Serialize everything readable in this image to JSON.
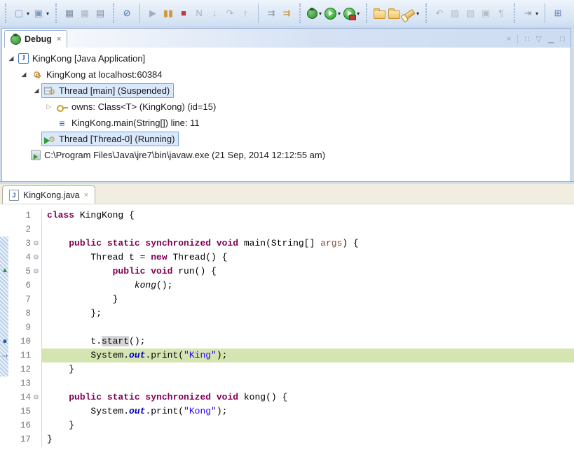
{
  "toolbar": {
    "groups": [
      {
        "sep": "dots",
        "items": [
          {
            "name": "new-button",
            "glyph": "▢",
            "color": "#7a98c0",
            "dropdown": true
          },
          {
            "name": "new-wizard-button",
            "glyph": "▣",
            "color": "#7a98c0",
            "dropdown": true
          }
        ]
      },
      {
        "sep": "dots",
        "items": [
          {
            "name": "save-button",
            "glyph": "▦",
            "color": "#7b8ca0"
          },
          {
            "name": "save-all-button",
            "glyph": "▦",
            "color": "#aab4be"
          },
          {
            "name": "print-button",
            "glyph": "▤",
            "color": "#7b8ca0"
          }
        ]
      },
      {
        "sep": "dots",
        "items": [
          {
            "name": "skip-all-breakpoints-button",
            "glyph": "⊘",
            "color": "#3a6ab0"
          }
        ]
      },
      {
        "sep": "line",
        "items": [
          {
            "name": "resume-button",
            "glyph": "▶",
            "color": "#9fafbf"
          },
          {
            "name": "suspend-button",
            "glyph": "▮▮",
            "color": "#d09a3a"
          },
          {
            "name": "terminate-button",
            "glyph": "■",
            "color": "#c03a3a"
          },
          {
            "name": "disconnect-button",
            "glyph": "N",
            "color": "#a8b2bc"
          },
          {
            "name": "step-into-button",
            "glyph": "↓",
            "color": "#a8b2bc"
          },
          {
            "name": "step-over-button",
            "glyph": "↷",
            "color": "#a8b2bc"
          },
          {
            "name": "step-return-button",
            "glyph": "↑",
            "color": "#a8b2bc"
          }
        ]
      },
      {
        "sep": "line",
        "items": [
          {
            "name": "step-filters-button",
            "glyph": "⇉",
            "color": "#8a97a8"
          },
          {
            "name": "use-step-filters-button",
            "glyph": "⇉",
            "color": "#c89232"
          }
        ]
      },
      {
        "sep": "dots",
        "items": [
          {
            "name": "debug-button",
            "css": "ci-bug",
            "dropdown": true
          },
          {
            "name": "run-button",
            "css": "ci-run",
            "dropdown": true
          },
          {
            "name": "run-external-tool-button",
            "css": "ci-run-ext",
            "dropdown": true
          }
        ]
      },
      {
        "sep": "dots",
        "items": [
          {
            "name": "open-type-button",
            "css": "ci-folder"
          },
          {
            "name": "open-resource-button",
            "css": "ci-folder"
          },
          {
            "name": "search-button",
            "css": "ci-torch",
            "dropdown": true
          }
        ]
      },
      {
        "sep": "dots",
        "items": [
          {
            "name": "last-edit-location-button",
            "glyph": "↶",
            "color": "#a8b2bc"
          },
          {
            "name": "format-button",
            "glyph": "▨",
            "color": "#b4bcc4"
          },
          {
            "name": "mark-occurrences-button",
            "glyph": "▧",
            "color": "#b4bcc4"
          },
          {
            "name": "show-selected-element-button",
            "glyph": "▣",
            "color": "#b4bcc4"
          },
          {
            "name": "show-whitespace-button",
            "glyph": "¶",
            "color": "#b4bcc4"
          }
        ]
      },
      {
        "sep": "dots",
        "items": [
          {
            "name": "pin-editor-button",
            "glyph": "⇥",
            "color": "#8a97a8",
            "dropdown": true
          }
        ]
      },
      {
        "sep": "line",
        "items": [
          {
            "name": "open-perspective-button",
            "glyph": "⊞",
            "color": "#5a7ab0"
          }
        ]
      }
    ]
  },
  "debug": {
    "tab_label": "Debug",
    "actions": [
      {
        "name": "remove-all-terminated-button",
        "glyph": "×"
      },
      {
        "name": "view-options-button",
        "glyph": "∷"
      },
      {
        "name": "view-menu-button",
        "glyph": "▽"
      },
      {
        "name": "minimize-button",
        "glyph": "▁"
      },
      {
        "name": "maximize-button",
        "glyph": "□"
      }
    ],
    "tree": [
      {
        "indent": 0,
        "exp": "open",
        "icon": "java-app",
        "label": "KingKong [Java Application]"
      },
      {
        "indent": 1,
        "exp": "open",
        "icon": "debug-target",
        "label": "KingKong at localhost:60384"
      },
      {
        "indent": 2,
        "exp": "open",
        "icon": "thread-suspended",
        "label": "Thread [main] (Suspended)",
        "selected": true
      },
      {
        "indent": 3,
        "exp": "closed",
        "icon": "key",
        "label": "owns: Class<T> (KingKong) (id=15)"
      },
      {
        "indent": 3,
        "exp": null,
        "icon": "stack-frame",
        "label": "KingKong.main(String[]) line: 11"
      },
      {
        "indent": 2,
        "exp": null,
        "icon": "thread-running",
        "label": "Thread [Thread-0] (Running)",
        "selected": true
      },
      {
        "indent": 1,
        "exp": null,
        "icon": "process",
        "label": "C:\\Program Files\\Java\\jre7\\bin\\javaw.exe (21 Sep, 2014 12:12:55 am)"
      }
    ]
  },
  "editor": {
    "tab_label": "KingKong.java",
    "file_icon_letter": "J",
    "lines": [
      {
        "num": "1",
        "segs": [
          [
            "k",
            "class"
          ],
          [
            "p",
            " KingKong {"
          ]
        ]
      },
      {
        "num": "2",
        "segs": []
      },
      {
        "num": "3",
        "fold": true,
        "segs": [
          [
            "p",
            "    "
          ],
          [
            "k",
            "public static synchronized void"
          ],
          [
            "p",
            " main(String[] "
          ],
          [
            "a",
            "args"
          ],
          [
            "p",
            ") {"
          ]
        ]
      },
      {
        "num": "4",
        "fold": true,
        "segs": [
          [
            "p",
            "        Thread t = "
          ],
          [
            "k",
            "new"
          ],
          [
            "p",
            " Thread() {"
          ]
        ]
      },
      {
        "num": "5",
        "fold": true,
        "marker": "override",
        "segs": [
          [
            "p",
            "            "
          ],
          [
            "k",
            "public void"
          ],
          [
            "p",
            " run() {"
          ]
        ]
      },
      {
        "num": "6",
        "segs": [
          [
            "p",
            "                "
          ],
          [
            "i",
            "kong"
          ],
          [
            "p",
            "();"
          ]
        ]
      },
      {
        "num": "7",
        "segs": [
          [
            "p",
            "            }"
          ]
        ]
      },
      {
        "num": "8",
        "segs": [
          [
            "p",
            "        };"
          ]
        ]
      },
      {
        "num": "9",
        "segs": []
      },
      {
        "num": "10",
        "marker": "breakpoint",
        "segs": [
          [
            "p",
            "        t."
          ],
          [
            "o",
            "start"
          ],
          [
            "p",
            "();"
          ]
        ]
      },
      {
        "num": "11",
        "marker": "ip",
        "hl": true,
        "segs": [
          [
            "p",
            "        System."
          ],
          [
            "f",
            "out"
          ],
          [
            "p",
            ".print("
          ],
          [
            "s",
            "\"King\""
          ],
          [
            "p",
            ");"
          ]
        ]
      },
      {
        "num": "12",
        "segs": [
          [
            "p",
            "    }"
          ]
        ]
      },
      {
        "num": "13",
        "segs": []
      },
      {
        "num": "14",
        "fold": true,
        "segs": [
          [
            "p",
            "    "
          ],
          [
            "k",
            "public static synchronized void"
          ],
          [
            "p",
            " kong() {"
          ]
        ]
      },
      {
        "num": "15",
        "segs": [
          [
            "p",
            "        System."
          ],
          [
            "f",
            "out"
          ],
          [
            "p",
            ".print("
          ],
          [
            "s",
            "\"Kong\""
          ],
          [
            "p",
            ");"
          ]
        ]
      },
      {
        "num": "16",
        "segs": [
          [
            "p",
            "    }"
          ]
        ]
      },
      {
        "num": "17",
        "segs": [
          [
            "p",
            "}"
          ]
        ]
      }
    ]
  },
  "icons": {
    "close": "×",
    "dropdown": "▾",
    "expander_open": "◢",
    "expander_closed": "▷",
    "fold_collapse": "⊖",
    "override_marker": "▲",
    "breakpoint_marker": "●",
    "instruction_pointer_marker": "→"
  },
  "colors": {
    "keyword": "#7f0055",
    "string": "#2a00ff",
    "static_field": "#0000c0",
    "parameter": "#7f5540",
    "debug_line_highlight": "#d5e5b2",
    "occurrence_highlight": "#d6d6d6",
    "selection_background": "#d9e9fb",
    "selection_border": "#74a4d8",
    "window_background": "#cfdded"
  }
}
